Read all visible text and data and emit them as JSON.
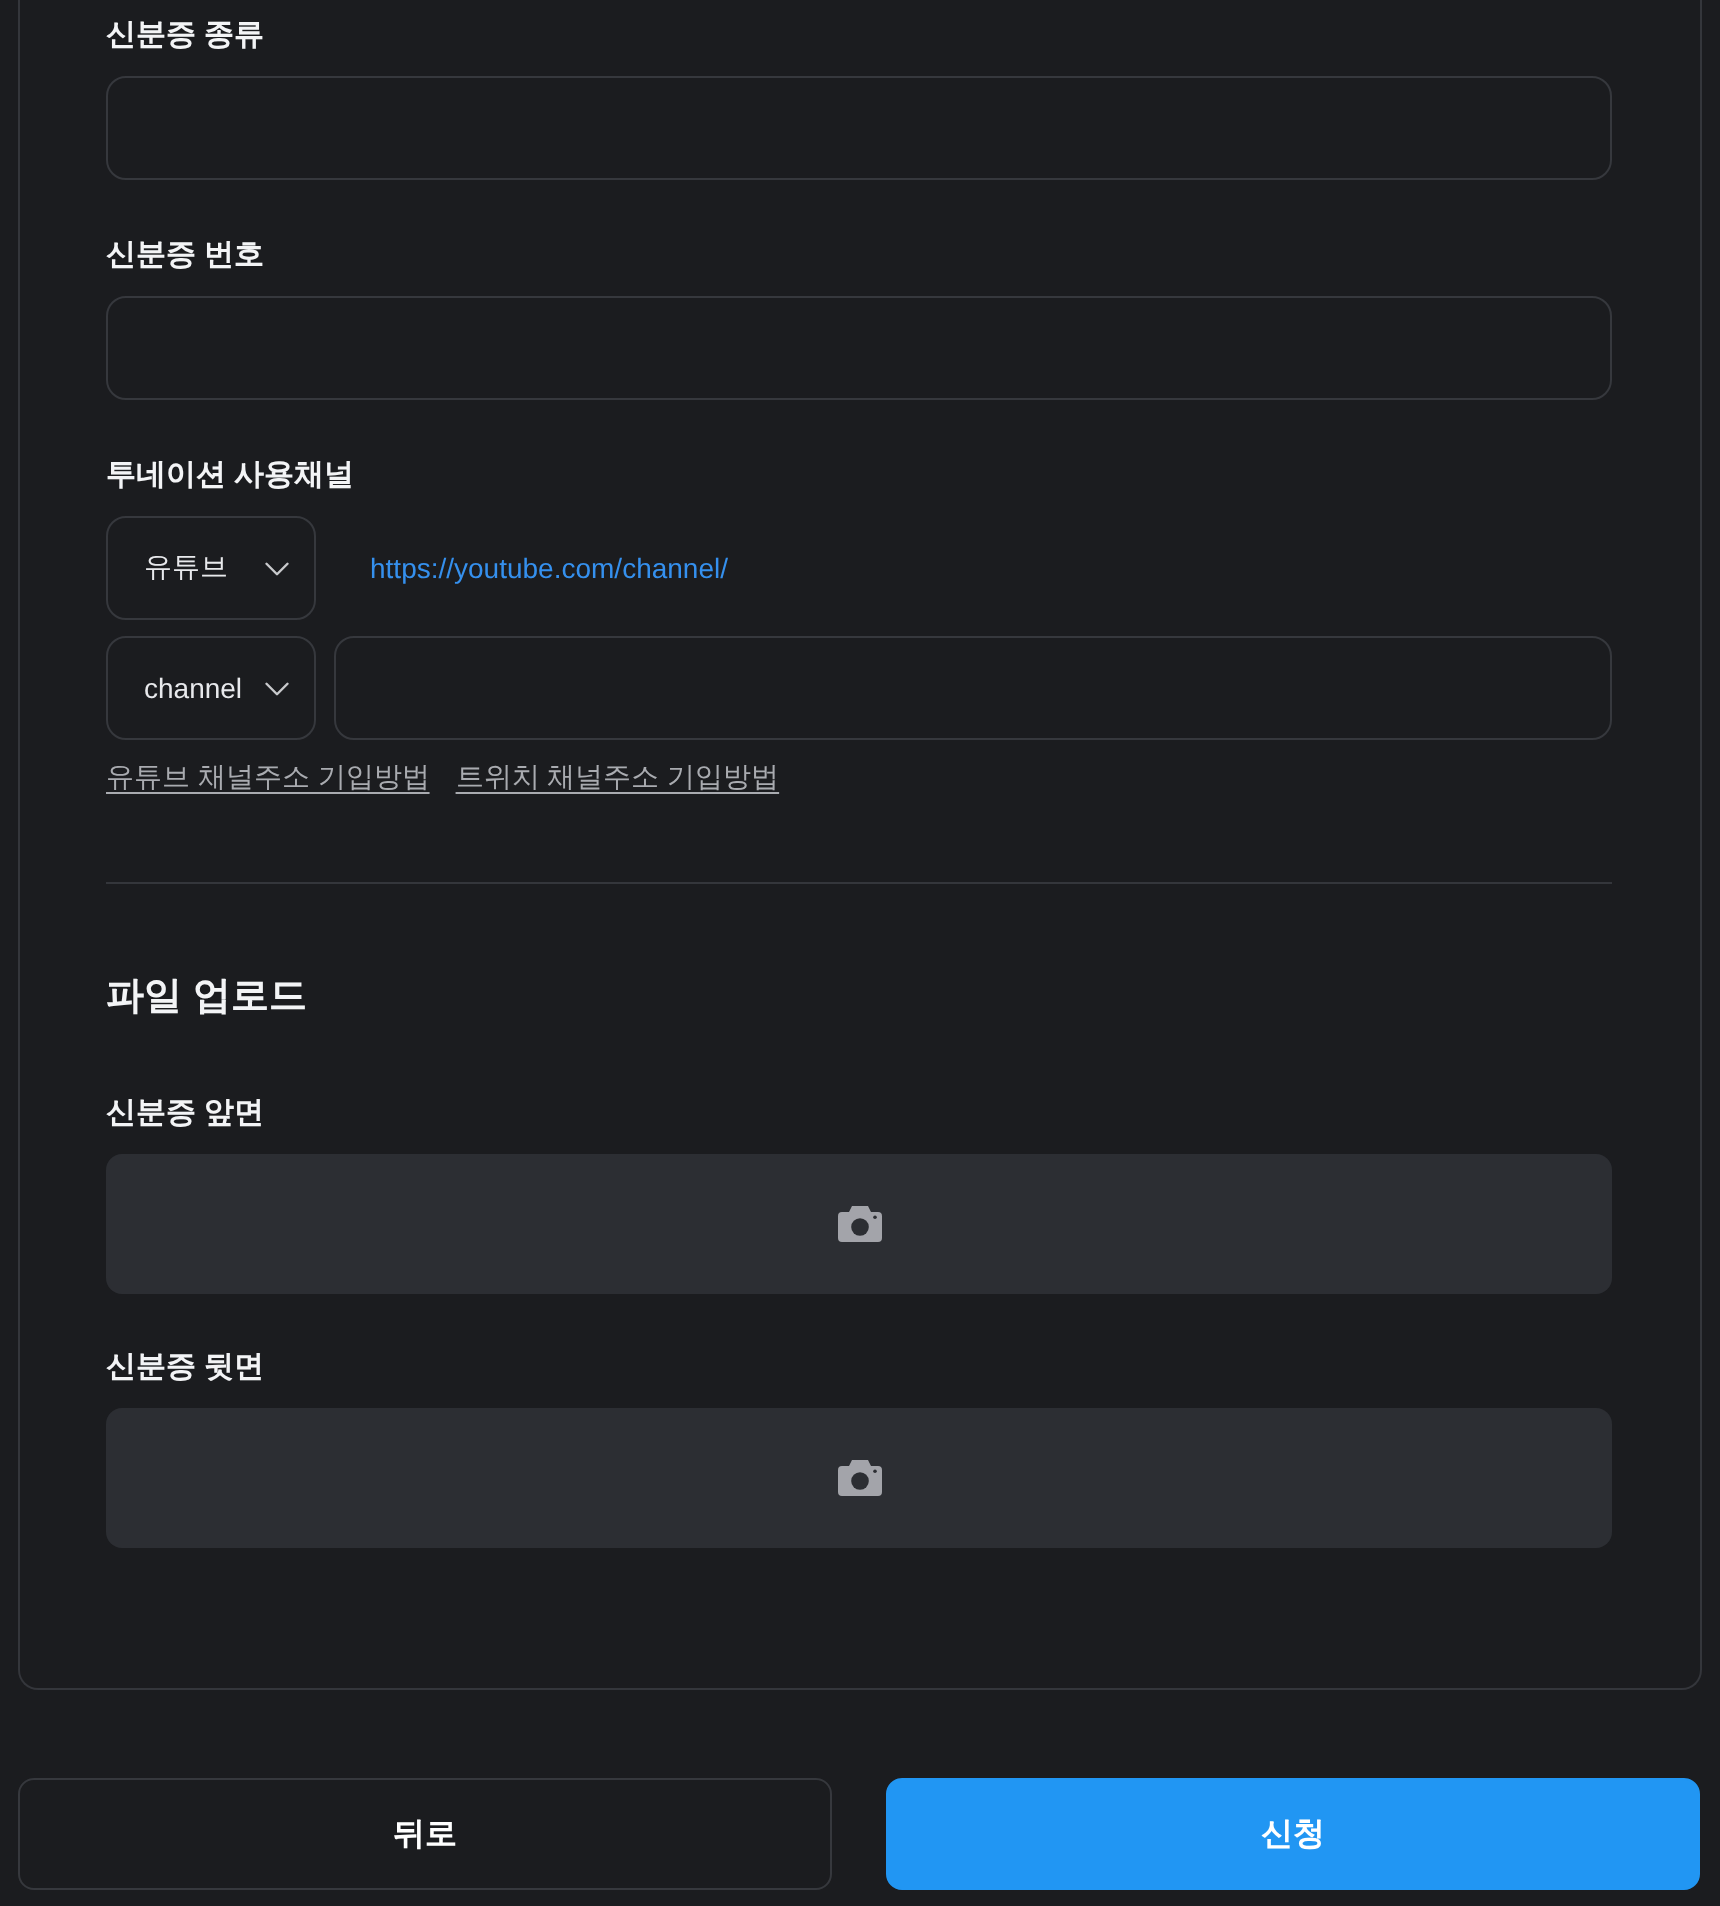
{
  "id_fields": [
    {
      "label": "신분증 종류"
    },
    {
      "label": "신분증 번호"
    }
  ],
  "channel": {
    "label": "투네이션 사용채널",
    "platform_select": {
      "value": "유튜브"
    },
    "url_prefix": "https://youtube.com/channel/",
    "type_select": {
      "value": "channel"
    },
    "help_links": [
      "유튜브 채널주소 기입방법",
      "트위치 채널주소 기입방법"
    ]
  },
  "upload": {
    "title": "파일 업로드",
    "slots": [
      {
        "label": "신분증 앞면"
      },
      {
        "label": "신분증 뒷면"
      }
    ]
  },
  "buttons": [
    {
      "label": "뒤로",
      "kind": "secondary"
    },
    {
      "label": "신청",
      "kind": "primary"
    }
  ]
}
